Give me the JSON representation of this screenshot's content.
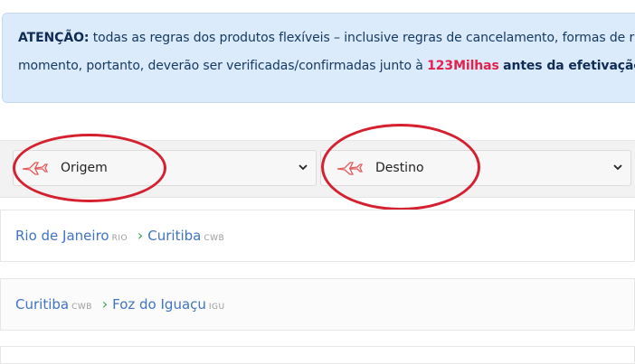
{
  "alert": {
    "prefix": "ATENÇÃO:",
    "line1": "todas as regras dos produtos flexíveis – inclusive regras de cancelamento, formas de r",
    "line2_a": "momento, portanto, deverão ser verificadas/confirmadas junto à ",
    "line2_brand": "123Milhas",
    "line2_b": "antes da efetivação"
  },
  "filters": {
    "origin_label": "Origem",
    "destination_label": "Destino",
    "icon": "airplane-icon"
  },
  "routes": [
    {
      "from": "Rio de Janeiro",
      "from_code": "RIO",
      "to": "Curitiba",
      "to_code": "CWB"
    },
    {
      "from": "Curitiba",
      "from_code": "CWB",
      "to": "Foz do Iguaçu",
      "to_code": "IGU"
    }
  ],
  "colors": {
    "accent": "#3f74c2",
    "brand": "#e2224d",
    "annotation": "#d4202f"
  }
}
